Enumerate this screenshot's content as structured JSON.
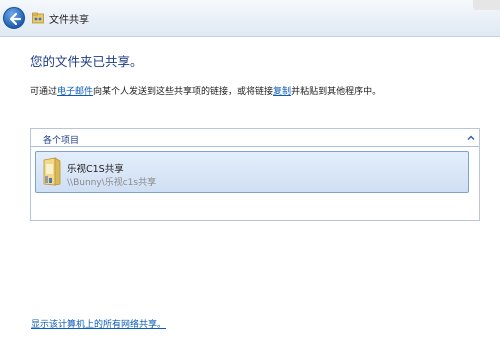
{
  "window": {
    "title": "文件共享"
  },
  "heading": "您的文件夹已共享。",
  "instruction": {
    "prefix": "可通过",
    "email_link": "电子邮件",
    "middle": "向某个人发送到这些共享项的链接，或将链接",
    "copy_link": "复制",
    "suffix": "并粘贴到其他程序中。"
  },
  "group": {
    "header": "各个项目",
    "items": [
      {
        "name": "乐视C1S共享",
        "path": "\\\\Bunny\\乐视c1s共享",
        "icon": "shared-folder-icon"
      }
    ]
  },
  "footer": {
    "show_all_link": "显示该计算机上的所有网络共享。"
  },
  "colors": {
    "heading": "#1c3b87",
    "link": "#0b5bb9",
    "selection_fill": "#dbe7f8",
    "selection_border": "#7da2ce"
  }
}
